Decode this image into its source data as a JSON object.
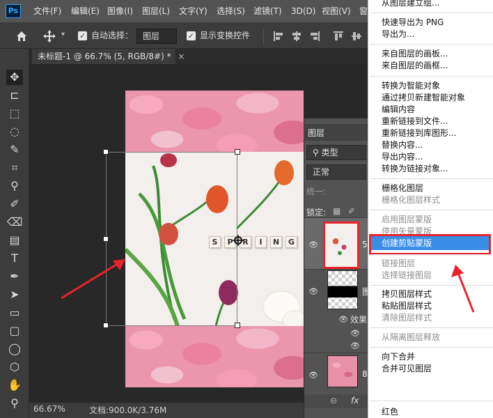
{
  "app": {
    "logo": "Ps"
  },
  "menubar": {
    "items": [
      "文件(F)",
      "编辑(E)",
      "图像(I)",
      "图层(L)",
      "文字(Y)",
      "选择(S)",
      "滤镜(T)",
      "3D(D)",
      "视图(V)",
      "窗"
    ]
  },
  "options": {
    "home_icon": "home-icon",
    "move_icon": "move-icon",
    "auto_select_label": "自动选择：",
    "auto_select_value": "图层",
    "show_transform_label": "显示变换控件",
    "checkmark": "✓"
  },
  "document": {
    "tab_title": "未标题-1 @ 66.7% (5, RGB/8#) *",
    "tab_close": "×"
  },
  "canvas": {
    "letters": [
      "S",
      "P",
      "R",
      "I",
      "N",
      "G"
    ]
  },
  "status": {
    "zoom": "66.67%",
    "doc_size": "文档:900.0K/3.76M"
  },
  "layers_panel": {
    "title": "图层",
    "kind": "类型",
    "blend": "正常",
    "unify": "统一:",
    "lock": "锁定:",
    "layer1_name": "5",
    "layer2_name": "图",
    "layer3_name": "8",
    "effects_label": "效果",
    "fx_button": "fx"
  },
  "context_menu": {
    "group1": [
      "从图层建立组..."
    ],
    "group2": [
      "快速导出为 PNG",
      "导出为..."
    ],
    "group3": [
      "来自图层的画板...",
      "来自图层的画框..."
    ],
    "group4": [
      "转换为智能对象",
      "通过拷贝新建智能对象",
      "编辑内容",
      "重新链接到文件...",
      "重新链接到库图形...",
      "替换内容...",
      "导出内容...",
      "转换为链接对象..."
    ],
    "group5": [
      "栅格化图层",
      "栅格化图层样式"
    ],
    "group6_disabled": [
      "启用图层蒙版",
      "停用矢量蒙版"
    ],
    "highlighted": "创建剪贴蒙版",
    "group7": [
      "链接图层",
      "选择链接图层"
    ],
    "group8": [
      "拷贝图层样式",
      "粘贴图层样式",
      "清除图层样式"
    ],
    "group9": [
      "从隔离图层释放"
    ],
    "group10": [
      "向下合并",
      "合并可见图层"
    ],
    "group11": [
      "红色"
    ]
  },
  "colors": {
    "accent_highlight": "#3a8ee6",
    "annotation_red": "#e8232b",
    "panel_bg": "#535353"
  }
}
